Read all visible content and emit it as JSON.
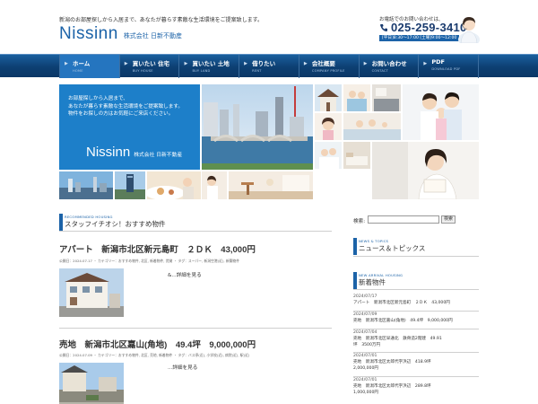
{
  "header": {
    "tagline": "新潟のお部屋探しから入居まで、あなたが暮らす素敵な生活環境をご提案致します。",
    "logo_word": "Nissinn",
    "logo_company": "株式会社 日新不動産",
    "tel_label": "お電話でのお問い合わせは、",
    "tel_number": "025-259-3410",
    "tel_hours": "[平日]8:30〜17:00 [土曜]9:00〜12:00"
  },
  "nav": {
    "items": [
      {
        "label": "ホーム",
        "sub": "HOME"
      },
      {
        "label": "買いたい 住宅",
        "sub": "BUY HOUSE"
      },
      {
        "label": "買いたい 土地",
        "sub": "BUY LAND"
      },
      {
        "label": "借りたい",
        "sub": "RENT"
      },
      {
        "label": "会社概要",
        "sub": "COMPANY PROFILE"
      },
      {
        "label": "お問い合わせ",
        "sub": "CONTACT"
      },
      {
        "label": "PDF",
        "sub": "DOWNLOAD PDF"
      }
    ]
  },
  "hero": {
    "line1": "お部屋探しから入居まで、",
    "line2": "あなたが暮らす素敵な生活環境をご提案致します。",
    "line3": "物件をお探しの方はお気軽にご来店ください。",
    "logo_word": "Nissinn",
    "logo_company": "株式会社 日新不動産"
  },
  "recommended": {
    "section_en": "RECOMMENDED HOUSING",
    "section_jp": "スタッフイチオシ！おすすめ物件",
    "properties": [
      {
        "title": "アパート　新潟市北区新元島町　２ＤＫ　43,000円",
        "meta": "公開日：2024.07.17 ・ カテゴリー：おすすめ物件, 北区, 新着物件, 賃貸 ・ タグ：スーパー, 新潟空港(近), 新築物件",
        "more": "&...詳細を見る"
      },
      {
        "title": "売地　新潟市北区嘉山(角地)　49.4坪　9,000,000円",
        "meta": "公開日：2024.07.09 ・ カテゴリー：おすすめ物件, 北区, 売地, 新着物件 ・ タグ：バス停(近), 小学校(近), 病院(近), 駅(近)",
        "more": "...詳細を見る"
      }
    ]
  },
  "search": {
    "label": "検索:",
    "button": "検索",
    "value": ""
  },
  "news": {
    "section_en": "NEWS & TOPICS",
    "section_jp": "ニュース＆トピックス"
  },
  "new_arrival": {
    "section_en": "NEW ARRIVAL HOUSING",
    "section_jp": "新着物件",
    "items": [
      {
        "date": "2024/07/17",
        "line1": "アパート　新潟市北区新元島町　２ＤＫ　43,000円",
        "line2": ""
      },
      {
        "date": "2024/07/09",
        "line1": "売地　新潟市北区嘉山(角地)　49.4坪　9,000,000円",
        "line2": ""
      },
      {
        "date": "2024/07/04",
        "line1": "売地　新潟市北区早通北　鉄骨造2階建　49.91",
        "line2": "坪　3500万円"
      },
      {
        "date": "2024/07/01",
        "line1": "売地　新潟市北区太郎代字浜辺　418.9坪",
        "line2": "2,000,000円"
      },
      {
        "date": "2024/07/01",
        "line1": "売地　新潟市北区太郎代字浜辺　289.8坪",
        "line2": "1,000,000円"
      }
    ]
  },
  "colors": {
    "brand_blue": "#1c63a8",
    "nav_dark": "#0d3f72",
    "hero_blue": "#1d7fc9"
  }
}
